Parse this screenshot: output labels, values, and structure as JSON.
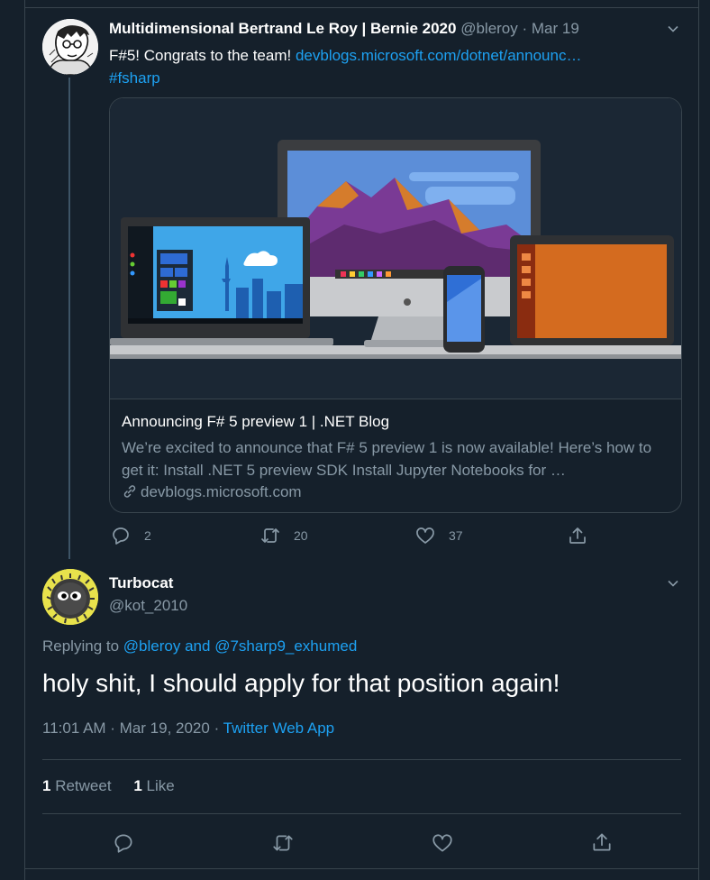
{
  "tweet1": {
    "display_name": "Multidimensional Bertrand Le Roy | Bernie 2020",
    "handle": "@bleroy",
    "date": "Mar 19",
    "text": "F#5! Congrats to the team!",
    "url": "devblogs.microsoft.com/dotnet/announc…",
    "hashtag": "#fsharp",
    "card": {
      "title": "Announcing F# 5 preview 1 | .NET Blog",
      "description": "We’re excited to announce that F# 5 preview 1 is now available! Here’s how to get it: Install .NET 5 preview SDK Install Jupyter Notebooks for …",
      "domain": "devblogs.microsoft.com"
    },
    "actions": {
      "replies": "2",
      "retweets": "20",
      "likes": "37"
    }
  },
  "tweet2": {
    "display_name": "Turbocat",
    "handle": "@kot_2010",
    "replying_label": "Replying to",
    "replying_to_1": "@bleroy",
    "replying_and": "and",
    "replying_to_2": "@7sharp9_exhumed",
    "text": "holy shit, I should apply for that position again!",
    "time": "11:01 AM · Mar 19, 2020",
    "source": "Twitter Web App",
    "retweet_count": "1",
    "retweet_label": "Retweet",
    "like_count": "1",
    "like_label": "Like"
  },
  "colors": {
    "background": "#15202b",
    "border": "#38444d",
    "secondary_text": "#8899a6",
    "link": "#1da1f2"
  },
  "icons": [
    "chevron-down-icon",
    "reply-icon",
    "retweet-icon",
    "like-icon",
    "share-icon",
    "link-icon"
  ]
}
